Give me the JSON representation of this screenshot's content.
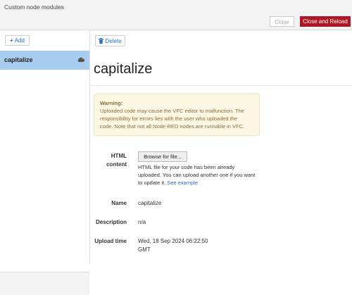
{
  "window": {
    "title": "Custom node modules"
  },
  "toolbar": {
    "close_label": "Close",
    "close_reload_label": "Close and Reload"
  },
  "sidebar": {
    "add_label": "Add",
    "items": [
      {
        "label": "capitalize"
      }
    ]
  },
  "main": {
    "delete_label": "Delete",
    "module_name": "capitalize",
    "warning": {
      "title": "Warning:",
      "lines": [
        "Uploaded code may cause the VFC editor to malfunction. The",
        "responsibility for errors lies with the user who uploaded the",
        "code. Note that not all Node-RED nodes are runnable in VFC."
      ]
    },
    "html_content": {
      "label_line1": "HTML",
      "label_line2": "content",
      "browse_label": "Browse for file...",
      "help_lines": [
        "HTML file for your code has been already",
        "uploaded. You can upload another one if you want",
        "to update it."
      ],
      "help_link": "See example"
    },
    "name": {
      "label": "Name",
      "value": "capitalize"
    },
    "description": {
      "label": "Description",
      "value": "n/a"
    },
    "upload_time": {
      "label": "Upload time",
      "value_line1": "Wed, 18 Sep 2024 06:22:50",
      "value_line2": "GMT"
    }
  }
}
